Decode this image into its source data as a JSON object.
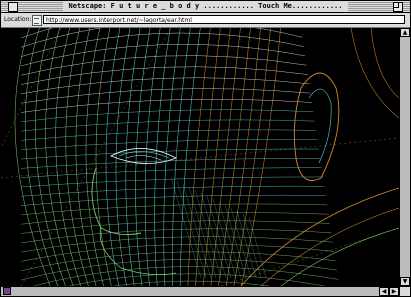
{
  "window": {
    "title": "Netscape: F u t u r e _ b o d y ............ Touch Me............"
  },
  "location_bar": {
    "label": "Location:",
    "url": "http://www.users.interport.net/~lagorta/ear.html"
  },
  "colors": {
    "wire_cyan": "#5fd6c8",
    "wire_green": "#7ad070",
    "wire_orange": "#d08a30",
    "wire_white": "#e8f4f4",
    "background": "#000000"
  },
  "icons": {
    "close": "close-box",
    "zoom": "zoom-box",
    "location": "bookmark-icon",
    "scroll_up": "arrow-up-icon",
    "scroll_down": "arrow-down-icon",
    "scroll_left": "arrow-left-icon",
    "scroll_right": "arrow-right-icon",
    "status": "security-key-icon"
  }
}
